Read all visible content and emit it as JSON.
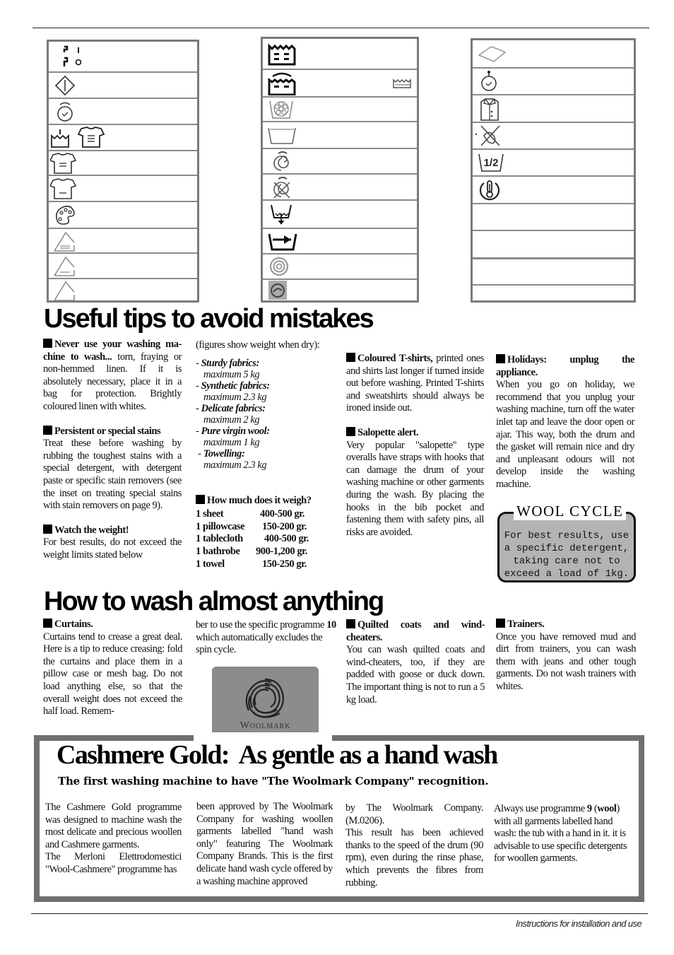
{
  "icon_tables": {
    "left": [
      "start-stop-icon",
      "start-reset-icon",
      "delay-timer-icon",
      "wash-shirt-icon",
      "shirt-easy-iron-icon",
      "shirt-icon",
      "colour-palette-icon",
      "iron-steam-icon",
      "iron-low-icon",
      "iron-icon"
    ],
    "middle": [
      "prewash-tub-icon",
      "rinse-tub-icon",
      "delicate-tub-icon",
      "tub-icon",
      "spin-icon",
      "no-spin-icon",
      "drain-icon",
      "rinse-hold-icon",
      "wool-icon",
      "woolmark-small-icon"
    ],
    "right": [
      "stain-icon",
      "timer-icon",
      "shirt-button-icon",
      "no-crease-icon",
      "half-load-icon",
      "temperature-icon",
      "",
      "",
      "",
      ""
    ]
  },
  "half_load_label": "1/2",
  "tips": {
    "heading": "Useful tips to avoid mistakes",
    "never_title": "Never use your washing ma-chine to wash...",
    "never_text": " torn, fraying or non-hemmed linen. If it is absolutely necessary, place it in a bag for protection. Brightly coloured linen with whites.",
    "stains_title": "Persistent or special stains",
    "stains_text": "Treat these before washing by rubbing the toughest stains with a special detergent, with detergent paste or specific stain removers (see the inset on treating special stains with stain removers on page 9).",
    "weight_title": "Watch the weight!",
    "weight_text": "For best results, do not exceed the weight limits stated below",
    "weight_note": "(figures show weight when dry):",
    "fabrics": [
      {
        "name": "Sturdy fabrics:",
        "max": "maximum 5 kg"
      },
      {
        "name": "Synthetic fabrics:",
        "max": "maximum 2.3 kg"
      },
      {
        "name": "Delicate fabrics:",
        "max": "maximum 2 kg"
      },
      {
        "name": "Pure virgin wool:",
        "max": "maximum 1 kg"
      },
      {
        "name": "Towelling:",
        "max": "maximum 2.3 kg"
      }
    ],
    "how_much_title": "How much does it weigh?",
    "items": [
      {
        "item": "1 sheet",
        "weight": "400-500 gr."
      },
      {
        "item": "1 pillowcase",
        "weight": "150-200 gr."
      },
      {
        "item": "1 tablecloth",
        "weight": "400-500 gr."
      },
      {
        "item": "1 bathrobe",
        "weight": "900-1,200 gr."
      },
      {
        "item": "1 towel",
        "weight": "150-250 gr."
      }
    ],
    "tshirts_title": "Coloured T-shirts,",
    "tshirts_text": " printed ones and shirts last longer if turned inside out before washing. Printed T-shirts and sweatshirts should always be ironed inside out.",
    "salopette_title": "Salopette alert.",
    "salopette_text": "Very popular \"salopette\" type overalls have straps with hooks that can damage the drum of your washing machine or other garments during the wash. By placing the hooks in the bib pocket and fastening them with safety pins, all risks are avoided.",
    "holidays_title": "Holidays: unplug the appliance.",
    "holidays_text": "When you go on holiday, we recommend that you unplug your washing machine, turn off the water inlet tap and leave the door open or ajar. This way, both the drum and the gasket will remain nice and dry and unpleasant odours will not develop inside the washing machine."
  },
  "wool_cycle": {
    "title": "WOOL CYCLE",
    "lines": [
      "For best results, use",
      "a specific detergent,",
      "taking care not to",
      "exceed a load of 1kg."
    ]
  },
  "wash": {
    "heading": "How to wash almost anything",
    "curtains_title": "Curtains.",
    "curtains_text": "Curtains tend to crease a great deal. Here is a tip to reduce creasing: fold the curtains and place them in a pillow case or mesh bag. Do not load anything else, so that the overall weight does not exceed the half load. Remem-",
    "curtains_cont_a": "ber to use the specific programme ",
    "curtains_prog": "10",
    "curtains_cont_b": " which automatically excludes the spin cycle.",
    "quilted_title": "Quilted coats and wind-cheaters.",
    "quilted_text": "You can wash quilted coats and wind-cheaters, too, if they are padded with goose or duck down. The important thing is not to run a 5 kg load.",
    "trainers_title": "Trainers.",
    "trainers_text": "Once you have removed mud and dirt from trainers, you can wash them with jeans and other tough garments. Do not wash trainers with whites."
  },
  "woolmark": {
    "label": "Woolmark"
  },
  "cashmere": {
    "title": "Cashmere Gold:  As gentle as a hand wash",
    "subtitle": "The first washing machine to have \"The Woolmark Company\" recognition.",
    "p1": "The Cashmere Gold programme was designed to machine wash the most delicate and precious woollen and Cashmere garments.",
    "p2": "The Merloni Elettrodomestici \"Wool-Cashmere\" programme has",
    "p3": "been approved by The Woolmark Company for washing woollen garments labelled \"hand wash only\" featuring The Woolmark Company Brands. This is the first delicate hand wash cycle offered by a washing machine approved",
    "p4": "by The Woolmark Company. (M.0206).",
    "p5": "This result has been achieved thanks to the speed of the drum (90 rpm), even during the rinse phase, which prevents the fibres from rubbing.",
    "p6a": "Always use programme ",
    "p6_prog": "9",
    "p6_paren_open": " (",
    "p6_wool": "wool",
    "p6b": ") with all garments labelled hand wash: the tub with a hand in it. it is advisable to use specific detergents for woollen garments."
  },
  "footer": "Instructions for installation and use"
}
